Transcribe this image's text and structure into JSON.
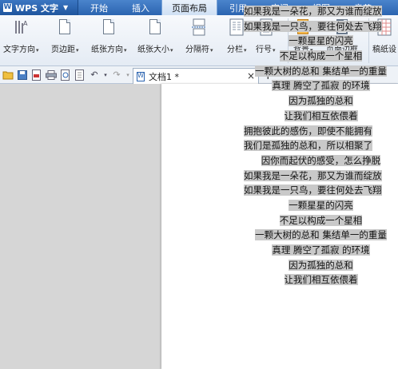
{
  "app": {
    "name": "WPS 文字"
  },
  "menu_tabs": [
    "开始",
    "插入",
    "页面布局",
    "引用",
    "审阅",
    "视图",
    "章节"
  ],
  "active_tab": "页面布局",
  "ribbon": {
    "text_direction": "文字方向",
    "margins": "页边距",
    "orientation": "纸张方向",
    "size": "纸张大小",
    "breaks": "分隔符",
    "columns": "分栏",
    "line_numbers": "行号",
    "background": "背景",
    "page_border": "页面边框",
    "draft": "稿纸设"
  },
  "doc_tab": {
    "title": "文档1 *"
  },
  "document_lines": [
    "如果我是一朵花，那又为谁而绽放",
    "如果我是一只鸟，要往何处去飞翔",
    "一颗星星的闪亮",
    "不足以构成一个星相",
    "一颗大树的总和 集结单一的重量",
    "真理 腾空了孤寂 的环境",
    "因为孤独的总和",
    "让我们相互依偎着",
    "拥抱彼此的感伤，即使不能拥有",
    "我们是孤独的总和，所以相聚了",
    "因你而起伏的感受，怎么挣脱",
    "如果我是一朵花，那又为谁而绽放",
    "如果我是一只鸟，要往何处去飞翔",
    "一颗星星的闪亮",
    "不足以构成一个星相",
    "一颗大树的总和 集结单一的重量",
    "真理 腾空了孤寂 的环境",
    "因为孤独的总和",
    "让我们相互依偎着"
  ],
  "colors": {
    "title_bar": "#2b64b0",
    "selection": "#c9c9c9"
  },
  "icons": [
    "folder-icon",
    "save-icon",
    "print-icon",
    "undo-icon",
    "redo-icon",
    "close-icon",
    "add-tab-icon"
  ]
}
